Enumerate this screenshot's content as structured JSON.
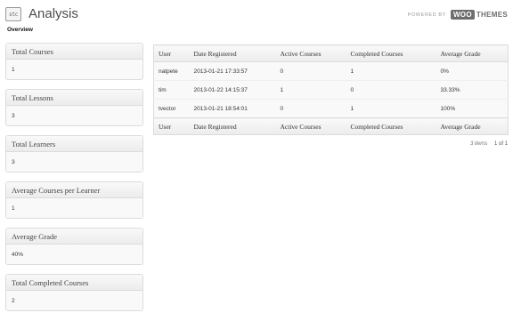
{
  "header": {
    "icon_text": "stc",
    "title": "Analysis"
  },
  "brand": {
    "powered_by": "POWERED BY",
    "woo": "WOO",
    "themes": "THEMES"
  },
  "subnav": {
    "overview": "Overview"
  },
  "stats": [
    {
      "label": "Total Courses",
      "value": "1"
    },
    {
      "label": "Total Lessons",
      "value": "3"
    },
    {
      "label": "Total Learners",
      "value": "3"
    },
    {
      "label": "Average Courses per Learner",
      "value": "1"
    },
    {
      "label": "Average Grade",
      "value": "40%"
    },
    {
      "label": "Total Completed Courses",
      "value": "2"
    }
  ],
  "table": {
    "columns": [
      "User",
      "Date Registered",
      "Active Courses",
      "Completed Courses",
      "Average Grade"
    ],
    "rows": [
      [
        "natpete",
        "2013-01-21 17:33:57",
        "0",
        "1",
        "0%"
      ],
      [
        "tim",
        "2013-01-22 14:15:37",
        "1",
        "0",
        "33.33%"
      ],
      [
        "tvector",
        "2013-01-21 18:54:01",
        "0",
        "1",
        "100%"
      ]
    ]
  },
  "pagination": {
    "items": "3 items",
    "pages": "1 of 1"
  }
}
